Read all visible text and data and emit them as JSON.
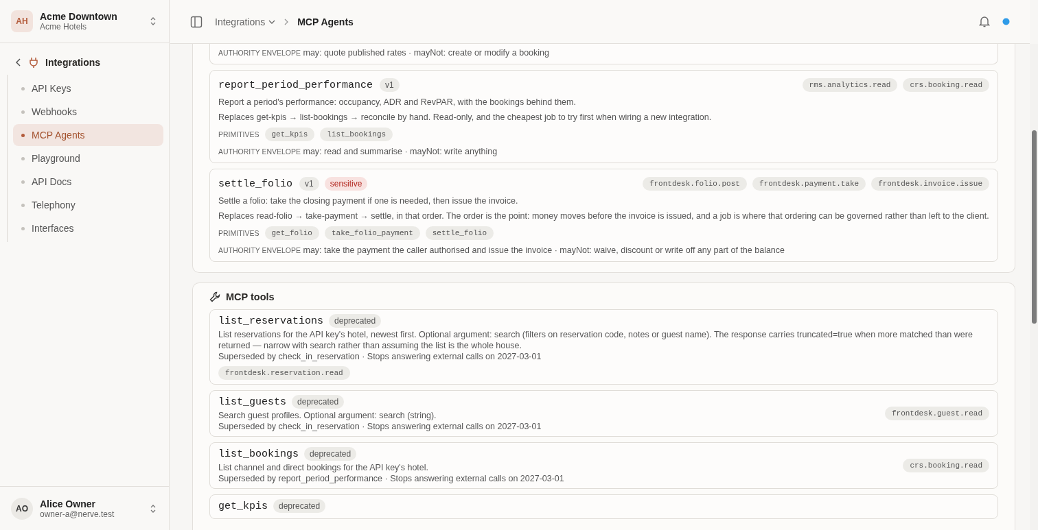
{
  "org": {
    "initials": "AH",
    "name": "Acme Downtown",
    "subtitle": "Acme Hotels"
  },
  "sidebar": {
    "section": "Integrations",
    "items": [
      {
        "label": "API Keys",
        "selected": false
      },
      {
        "label": "Webhooks",
        "selected": false
      },
      {
        "label": "MCP Agents",
        "selected": true
      },
      {
        "label": "Playground",
        "selected": false
      },
      {
        "label": "API Docs",
        "selected": false
      },
      {
        "label": "Telephony",
        "selected": false
      },
      {
        "label": "Interfaces",
        "selected": false
      }
    ]
  },
  "user": {
    "initials": "AO",
    "name": "Alice Owner",
    "email": "owner-a@nerve.test"
  },
  "topbar": {
    "breadcrumb": [
      {
        "label": "Integrations",
        "kind": "dropdown"
      },
      {
        "label": "MCP Agents",
        "kind": "current"
      }
    ]
  },
  "jobs": [
    {
      "partial": true,
      "authority_label": "AUTHORITY ENVELOPE",
      "authority": "may: quote published rates · mayNot: create or modify a booking"
    },
    {
      "partial": false,
      "name": "report_period_performance",
      "badges": [
        {
          "label": "v1",
          "kind": "version"
        }
      ],
      "scopes": [
        "rms.analytics.read",
        "crs.booking.read"
      ],
      "description": "Report a period's performance: occupancy, ADR and RevPAR, with the bookings behind them.",
      "replaces": "Replaces get-kpis → list-bookings → reconcile by hand. Read-only, and the cheapest job to try first when wiring a new integration.",
      "primitives_label": "PRIMITIVES",
      "primitives": [
        "get_kpis",
        "list_bookings"
      ],
      "authority_label": "AUTHORITY ENVELOPE",
      "authority": "may: read and summarise · mayNot: write anything"
    },
    {
      "partial": false,
      "name": "settle_folio",
      "badges": [
        {
          "label": "v1",
          "kind": "version"
        },
        {
          "label": "sensitive",
          "kind": "sensitive"
        }
      ],
      "scopes": [
        "frontdesk.folio.post",
        "frontdesk.payment.take",
        "frontdesk.invoice.issue"
      ],
      "description": "Settle a folio: take the closing payment if one is needed, then issue the invoice.",
      "replaces": "Replaces read-folio → take-payment → settle, in that order. The order is the point: money moves before the invoice is issued, and a job is where that ordering can be governed rather than left to the client.",
      "primitives_label": "PRIMITIVES",
      "primitives": [
        "get_folio",
        "take_folio_payment",
        "settle_folio"
      ],
      "authority_label": "AUTHORITY ENVELOPE",
      "authority": "may: take the payment the caller authorised and issue the invoice · mayNot: waive, discount or write off any part of the balance"
    }
  ],
  "tools": {
    "title": "MCP tools",
    "items": [
      {
        "kind": "stacked",
        "name": "list_reservations",
        "badge": "deprecated",
        "description": "List reservations for the API key's hotel, newest first. Optional argument: search (filters on reservation code, notes or guest name). The response carries truncated=true when more matched than were returned — narrow with search rather than assuming the list is the whole house.",
        "superseded": "Superseded by check_in_reservation · Stops answering external calls on 2027-03-01",
        "scopes": [
          "frontdesk.reservation.read"
        ]
      },
      {
        "kind": "inline",
        "name": "list_guests",
        "badge": "deprecated",
        "description": "Search guest profiles. Optional argument: search (string).",
        "superseded": "Superseded by check_in_reservation · Stops answering external calls on 2027-03-01",
        "scopes": [
          "frontdesk.guest.read"
        ]
      },
      {
        "kind": "inline",
        "name": "list_bookings",
        "badge": "deprecated",
        "description": "List channel and direct bookings for the API key's hotel.",
        "superseded": "Superseded by report_period_performance · Stops answering external calls on 2027-03-01",
        "scopes": [
          "crs.booking.read"
        ]
      },
      {
        "kind": "cut",
        "name": "get_kpis",
        "badge": "deprecated"
      }
    ]
  }
}
